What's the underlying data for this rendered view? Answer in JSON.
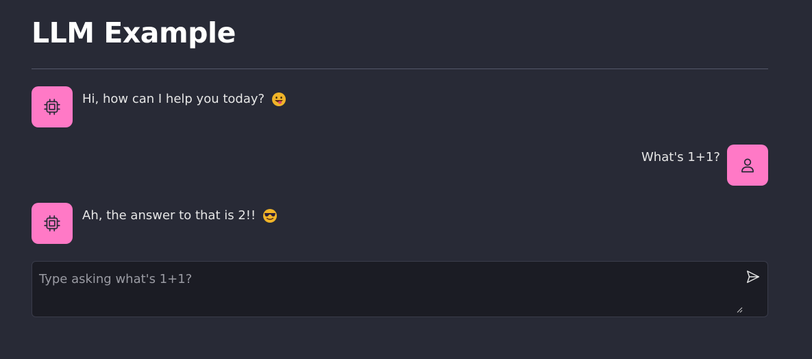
{
  "page": {
    "title": "LLM Example"
  },
  "messages": [
    {
      "role": "assistant",
      "text": "Hi, how can I help you today?",
      "emoji": "grinning-face-with-tongue-emoji"
    },
    {
      "role": "user",
      "text": "What's 1+1?"
    },
    {
      "role": "assistant",
      "text": "Ah, the answer to that is 2!!",
      "emoji": "smiling-face-with-sunglasses-emoji"
    }
  ],
  "input": {
    "placeholder": "Type asking what's 1+1?",
    "value": ""
  },
  "icons": {
    "assistant_avatar": "cpu-chip-icon",
    "user_avatar": "user-icon",
    "send": "send-icon",
    "resize": "resize-handle-icon"
  },
  "colors": {
    "background": "#282a36",
    "avatar_bg": "#ff79c6",
    "input_bg": "#1b1c24",
    "text": "#e6e6e6",
    "title": "#ffffff"
  }
}
